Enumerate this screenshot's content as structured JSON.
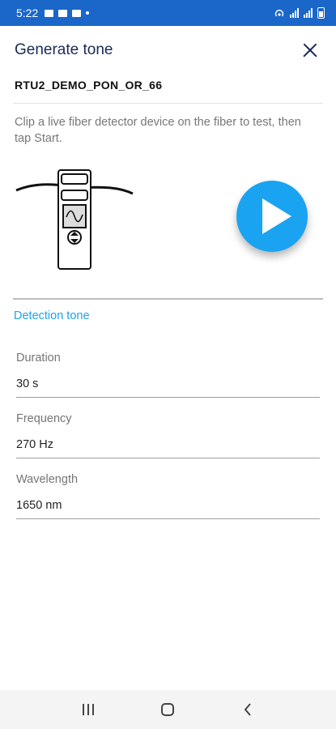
{
  "status_bar": {
    "time": "5:22"
  },
  "header": {
    "title": "Generate tone"
  },
  "device": {
    "name": "RTU2_DEMO_PON_OR_66"
  },
  "instructions": "Clip a live fiber detector device on the fiber to test, then tap Start.",
  "play_button": {
    "color": "#1aa3f0"
  },
  "section": {
    "title": "Detection tone"
  },
  "fields": [
    {
      "label": "Duration",
      "value": "30 s"
    },
    {
      "label": "Frequency",
      "value": "270 Hz"
    },
    {
      "label": "Wavelength",
      "value": "1650 nm"
    }
  ],
  "colors": {
    "status_bar": "#1a66c9",
    "accent": "#1aa3f0",
    "title": "#1b2a55"
  },
  "icons": {
    "close": "close-icon",
    "play": "play-icon",
    "nav_recent": "recent-apps-icon",
    "nav_home": "home-icon",
    "nav_back": "back-icon"
  }
}
